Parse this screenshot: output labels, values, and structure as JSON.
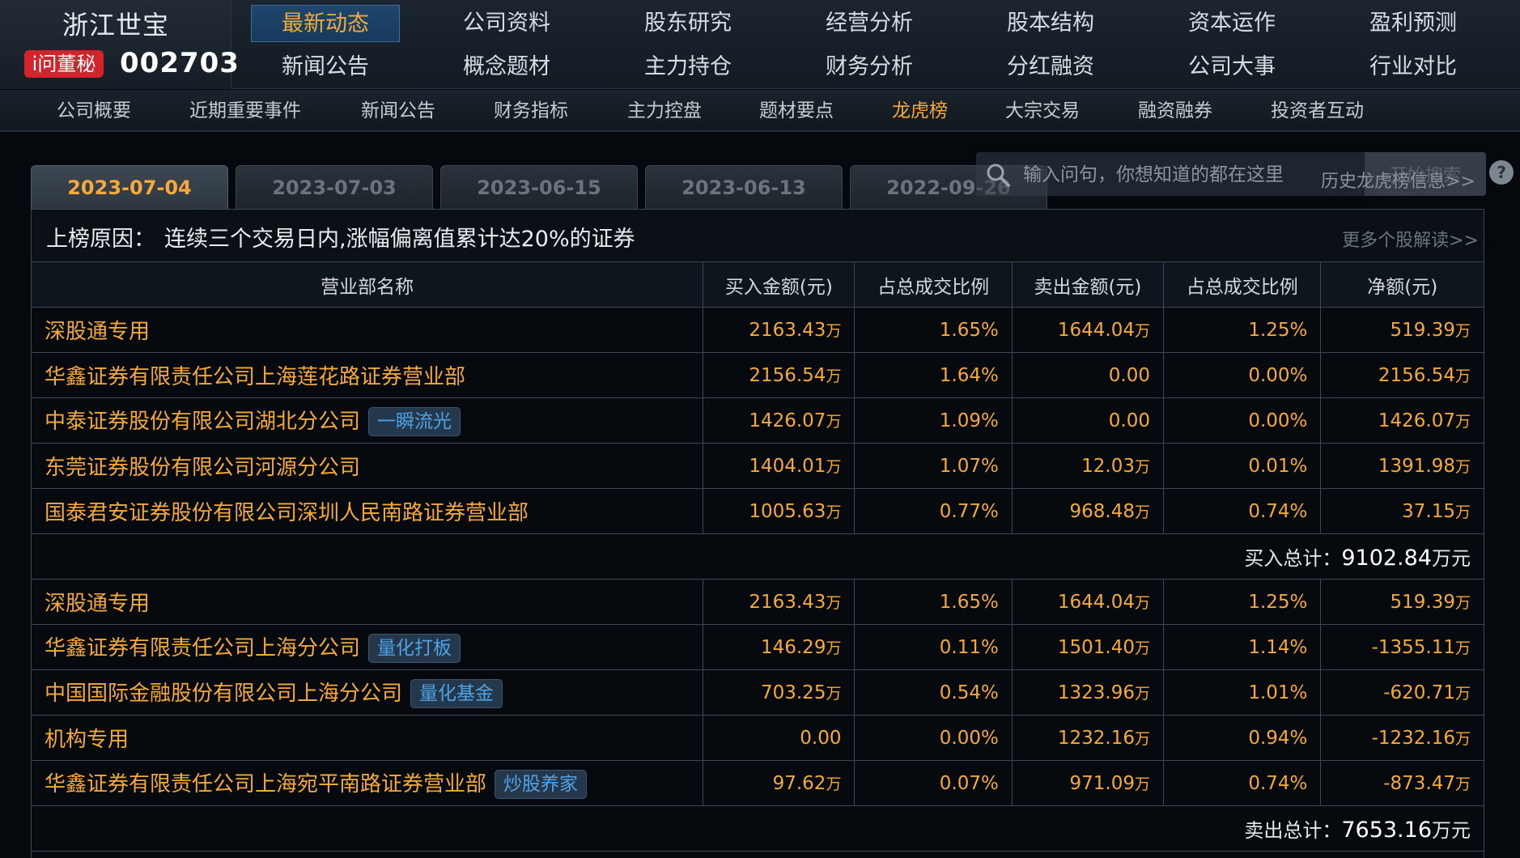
{
  "company": {
    "name": "浙江世宝",
    "badge": "i问董秘",
    "code": "002703"
  },
  "nav": {
    "row1": [
      "最新动态",
      "公司资料",
      "股东研究",
      "经营分析",
      "股本结构",
      "资本运作",
      "盈利预测"
    ],
    "row2": [
      "新闻公告",
      "概念题材",
      "主力持仓",
      "财务分析",
      "分红融资",
      "公司大事",
      "行业对比"
    ],
    "active": "最新动态"
  },
  "subnav": {
    "items": [
      "公司概要",
      "近期重要事件",
      "新闻公告",
      "财务指标",
      "主力控盘",
      "题材要点",
      "龙虎榜",
      "大宗交易",
      "融资融券",
      "投资者互动"
    ],
    "active": "龙虎榜"
  },
  "date_tabs": [
    "2023-07-04",
    "2023-07-03",
    "2023-06-15",
    "2023-06-13",
    "2022-09-26"
  ],
  "active_date": "2023-07-04",
  "search": {
    "placeholder": "输入问句，你想知道的都在这里",
    "button": "开始搜索",
    "icon": "search-icon"
  },
  "history_link": "历史龙虎榜信息>>",
  "help_icon": "?",
  "reason": {
    "label": "上榜原因：",
    "text": "连续三个交易日内,涨幅偏离值累计达20%的证券",
    "more": "更多个股解读>>"
  },
  "table": {
    "headers": [
      "营业部名称",
      "买入金额(元)",
      "占总成交比例",
      "卖出金额(元)",
      "占总成交比例",
      "净额(元)"
    ],
    "buy_rows": [
      {
        "name": "深股通专用",
        "tag": "",
        "buy": "2163.43",
        "buy_unit": "万",
        "buy_pct": "1.65%",
        "sell": "1644.04",
        "sell_unit": "万",
        "sell_pct": "1.25%",
        "net": "519.39",
        "net_unit": "万"
      },
      {
        "name": "华鑫证券有限责任公司上海莲花路证券营业部",
        "tag": "",
        "buy": "2156.54",
        "buy_unit": "万",
        "buy_pct": "1.64%",
        "sell": "0.00",
        "sell_unit": "",
        "sell_pct": "0.00%",
        "net": "2156.54",
        "net_unit": "万"
      },
      {
        "name": "中泰证券股份有限公司湖北分公司",
        "tag": "一瞬流光",
        "buy": "1426.07",
        "buy_unit": "万",
        "buy_pct": "1.09%",
        "sell": "0.00",
        "sell_unit": "",
        "sell_pct": "0.00%",
        "net": "1426.07",
        "net_unit": "万"
      },
      {
        "name": "东莞证券股份有限公司河源分公司",
        "tag": "",
        "buy": "1404.01",
        "buy_unit": "万",
        "buy_pct": "1.07%",
        "sell": "12.03",
        "sell_unit": "万",
        "sell_pct": "0.01%",
        "net": "1391.98",
        "net_unit": "万"
      },
      {
        "name": "国泰君安证券股份有限公司深圳人民南路证券营业部",
        "tag": "",
        "buy": "1005.63",
        "buy_unit": "万",
        "buy_pct": "0.77%",
        "sell": "968.48",
        "sell_unit": "万",
        "sell_pct": "0.74%",
        "net": "37.15",
        "net_unit": "万"
      }
    ],
    "buy_total": {
      "label": "买入总计：",
      "value": "9102.84",
      "unit": "万元"
    },
    "sell_rows": [
      {
        "name": "深股通专用",
        "tag": "",
        "buy": "2163.43",
        "buy_unit": "万",
        "buy_pct": "1.65%",
        "sell": "1644.04",
        "sell_unit": "万",
        "sell_pct": "1.25%",
        "net": "519.39",
        "net_unit": "万"
      },
      {
        "name": "华鑫证券有限责任公司上海分公司",
        "tag": "量化打板",
        "buy": "146.29",
        "buy_unit": "万",
        "buy_pct": "0.11%",
        "sell": "1501.40",
        "sell_unit": "万",
        "sell_pct": "1.14%",
        "net": "-1355.11",
        "net_unit": "万"
      },
      {
        "name": "中国国际金融股份有限公司上海分公司",
        "tag": "量化基金",
        "buy": "703.25",
        "buy_unit": "万",
        "buy_pct": "0.54%",
        "sell": "1323.96",
        "sell_unit": "万",
        "sell_pct": "1.01%",
        "net": "-620.71",
        "net_unit": "万"
      },
      {
        "name": "机构专用",
        "tag": "",
        "buy": "0.00",
        "buy_unit": "",
        "buy_pct": "0.00%",
        "sell": "1232.16",
        "sell_unit": "万",
        "sell_pct": "0.94%",
        "net": "-1232.16",
        "net_unit": "万"
      },
      {
        "name": "华鑫证券有限责任公司上海宛平南路证券营业部",
        "tag": "炒股养家",
        "buy": "97.62",
        "buy_unit": "万",
        "buy_pct": "0.07%",
        "sell": "971.09",
        "sell_unit": "万",
        "sell_pct": "0.74%",
        "net": "-873.47",
        "net_unit": "万"
      }
    ],
    "sell_total": {
      "label": "卖出总计：",
      "value": "7653.16",
      "unit": "万元"
    }
  },
  "colors": {
    "accent": "#f4a93a",
    "tag_text": "#4ea3e6",
    "badge_red": "#d3232c",
    "background": "#06090d"
  }
}
